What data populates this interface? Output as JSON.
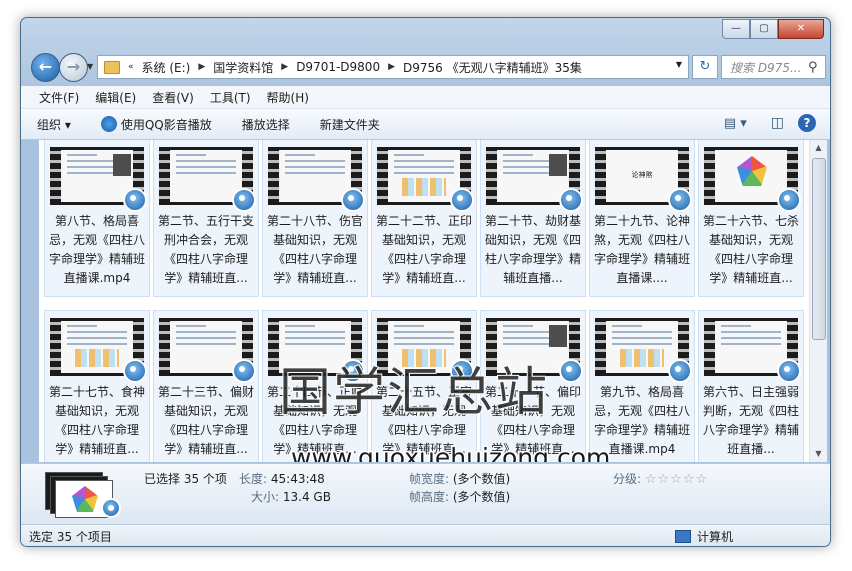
{
  "window": {
    "caption_buttons": [
      "—",
      "▢",
      "✕"
    ]
  },
  "address": {
    "overflow": "«",
    "crumbs": [
      "系统 (E:)",
      "国学资料馆",
      "D9701-D9800",
      "D9756 《无观八字精辅班》35集"
    ]
  },
  "search": {
    "placeholder": "搜索 D975..."
  },
  "menu": [
    "文件(F)",
    "编辑(E)",
    "查看(V)",
    "工具(T)",
    "帮助(H)"
  ],
  "toolbar": {
    "organize": "组织 ▾",
    "play_qq": "使用QQ影音播放",
    "play_select": "播放选择",
    "new_folder": "新建文件夹",
    "help": "?"
  },
  "files": [
    {
      "name": "第八节、格局喜忌，无观《四柱八字命理学》精辅班直播课.mp4",
      "label": "第八节、格局喜忌，无观《四柱八字命理学》精辅班直播课.mp4",
      "thumb": "doc-video"
    },
    {
      "name": "第二节、五行干支刑冲合会，无观《四柱八字命理学》精辅班直...",
      "label": "第二节、五行干支刑冲合会，无观《四柱八字命理学》精辅班直...",
      "thumb": "doc"
    },
    {
      "name": "第二十八节、伤官基础知识，无观《四柱八字命理学》精辅班直...",
      "label": "第二十八节、伤官基础知识，无观《四柱八字命理学》精辅班直...",
      "thumb": "doc"
    },
    {
      "name": "第二十二节、正印基础知识，无观《四柱八字命理学》精辅班直...",
      "label": "第二十二节、正印基础知识，无观《四柱八字命理学》精辅班直...",
      "thumb": "doc-table"
    },
    {
      "name": "第二十节、劫财基础知识，无观《四柱八字命理学》精辅班直播...",
      "label": "第二十节、劫财基础知识，无观《四柱八字命理学》精辅班直播...",
      "thumb": "doc-video"
    },
    {
      "name": "第二十九节、论神煞，无观《四柱八字命理学》精辅班直播课....",
      "label": "第二十九节、论神煞，无观《四柱八字命理学》精辅班直播课....",
      "thumb": "title",
      "thumb_text": "论神煞"
    },
    {
      "name": "第二十六节、七杀基础知识，无观《四柱八字命理学》精辅班直...",
      "label": "第二十六节、七杀基础知识，无观《四柱八字命理学》精辅班直...",
      "thumb": "pentagon"
    },
    {
      "name": "第二十七节、食神基础知识，无观《四柱八字命理学》精辅班直...",
      "label": "第二十七节、食神基础知识，无观《四柱八字命理学》精辅班直...",
      "thumb": "doc-table"
    },
    {
      "name": "第二十三节、偏财基础知识，无观《四柱八字命理学》精辅班直...",
      "label": "第二十三节、偏财基础知识，无观《四柱八字命理学》精辅班直...",
      "thumb": "doc"
    },
    {
      "name": "第二十四节、正财基础知识，无观《四柱八字命理学》精辅班直...",
      "label": "第二十四节、正财基础知识，无观《四柱八字命理学》精辅班直...",
      "thumb": "doc"
    },
    {
      "name": "第二十五节、正官基础知识，无观《四柱八字命理学》精辅班直...",
      "label": "第二十五节、正官基础知识，无观《四柱八字命理学》精辅班直...",
      "thumb": "doc-table"
    },
    {
      "name": "第二十一节、偏印基础知识，无观《四柱八字命理学》精辅班直...",
      "label": "第二十一节、偏印基础知识，无观《四柱八字命理学》精辅班直...",
      "thumb": "doc-video"
    },
    {
      "name": "第九节、格局喜忌，无观《四柱八字命理学》精辅班直播课.mp4",
      "label": "第九节、格局喜忌，无观《四柱八字命理学》精辅班直播课.mp4",
      "thumb": "doc-table"
    },
    {
      "name": "第六节、日主强弱判断，无观《四柱八字命理学》精辅班直播...",
      "label": "第六节、日主强弱判断，无观《四柱八字命理学》精辅班直播...",
      "thumb": "doc"
    }
  ],
  "watermark": {
    "title": "国学汇总站",
    "url": "www.guoxuehuizong.com"
  },
  "details": {
    "selected": "已选择 35 个项",
    "length_label": "长度:",
    "length": "45:43:48",
    "size_label": "大小:",
    "size": "13.4 GB",
    "width_label": "帧宽度:",
    "width": "(多个数值)",
    "height_label": "帧高度:",
    "height": "(多个数值)",
    "rating_label": "分级:",
    "rating": "☆☆☆☆☆"
  },
  "status": {
    "left": "选定 35 个项目",
    "right": "计算机"
  }
}
